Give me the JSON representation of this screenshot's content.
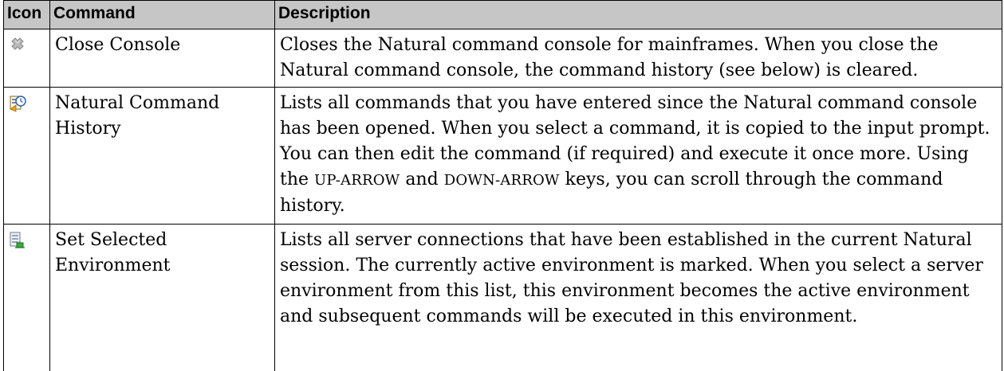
{
  "table": {
    "headers": {
      "icon": "Icon",
      "command": "Command",
      "description": "Description"
    },
    "rows": [
      {
        "icon": "close-console-icon",
        "command": "Close Console",
        "description": "Closes the Natural command console for mainframes. When you close the Natural command console, the command history (see below) is cleared."
      },
      {
        "icon": "command-history-icon",
        "command": "Natural Command History",
        "description_parts": {
          "part1": "Lists all commands that you have entered since the Natural command console has been opened. When you select a command, it is copied to the input prompt. You can then edit the command (if required) and execute it once more. Using the ",
          "key1": "UP-ARROW",
          "part2": " and ",
          "key2": "DOWN-ARROW",
          "part3": " keys, you can scroll through the command history."
        }
      },
      {
        "icon": "set-environment-icon",
        "command": "Set Selected Environment",
        "description": "Lists all server connections that have been established in the current Natural session. The currently active environment is marked. When you select a server environment from this list, this environment becomes the active environment and subsequent commands will be executed in this environment."
      }
    ]
  }
}
